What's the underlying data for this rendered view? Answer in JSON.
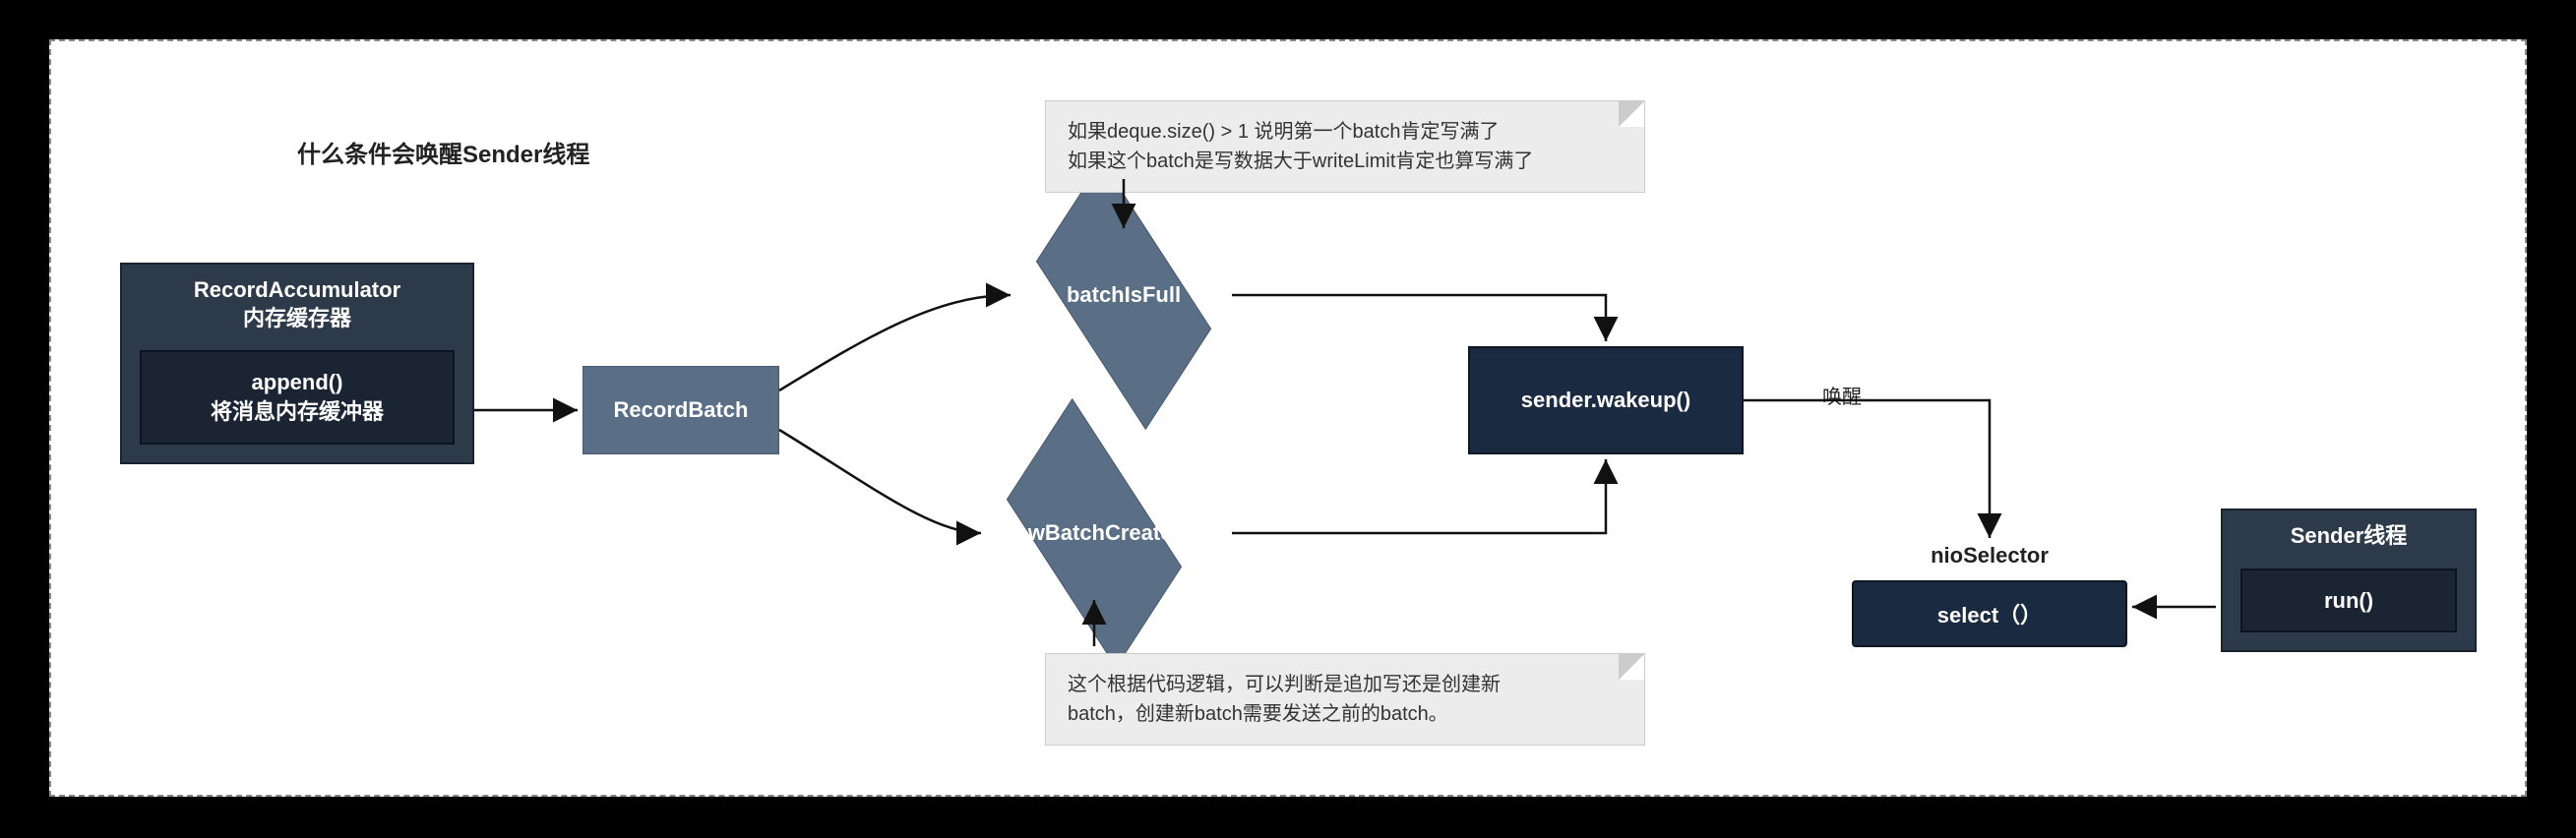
{
  "title": "什么条件会唤醒Sender线程",
  "recordAccumulator": {
    "header_line1": "RecordAccumulator",
    "header_line2": "内存缓存器",
    "inner_line1": "append()",
    "inner_line2": "将消息内存缓冲器"
  },
  "recordBatch": "RecordBatch",
  "decision1": "batchIsFull",
  "decision2": "newBatchCreated",
  "note1_line1": "如果deque.size() > 1 说明第一个batch肯定写满了",
  "note1_line2": "如果这个batch是写数据大于writeLimit肯定也算写满了",
  "note2_line1": "这个根据代码逻辑，可以判断是追加写还是创建新",
  "note2_line2": "batch，创建新batch需要发送之前的batch。",
  "wakeup": "sender.wakeup()",
  "wakeLabel": "唤醒",
  "selector": {
    "title": "nioSelector",
    "box": "select（）"
  },
  "sender": {
    "header": "Sender线程",
    "inner": "run()"
  }
}
